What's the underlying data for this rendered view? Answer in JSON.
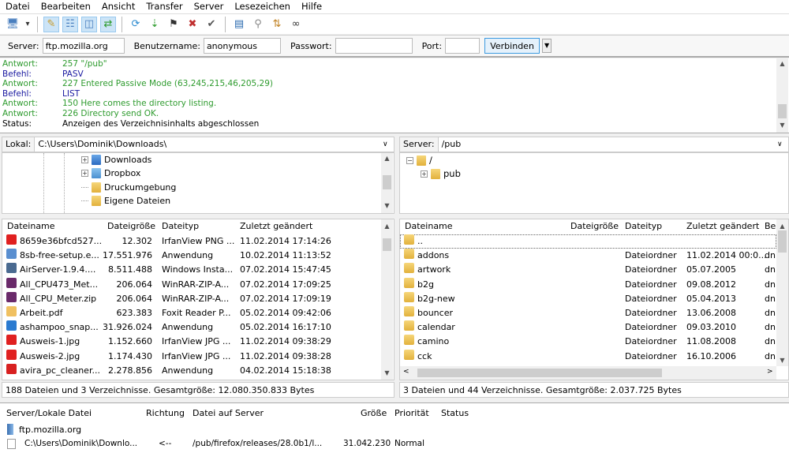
{
  "menu": [
    "Datei",
    "Bearbeiten",
    "Ansicht",
    "Transfer",
    "Server",
    "Lesezeichen",
    "Hilfe"
  ],
  "toolbar_icons": [
    "site-manager-icon",
    "dropdown-arrow-icon",
    "toggle-log-icon",
    "toggle-tree-icon",
    "toggle-remote-tree-icon",
    "toggle-queue-icon",
    "refresh-icon",
    "process-queue-icon",
    "cancel-icon",
    "disconnect-icon",
    "reconnect-icon",
    "directory-listing-filter-icon",
    "compare-directories-icon",
    "sync-browsing-icon",
    "search-icon"
  ],
  "quickconnect": {
    "server_label": "Server:",
    "server_value": "ftp.mozilla.org",
    "user_label": "Benutzername:",
    "user_value": "anonymous",
    "password_label": "Passwort:",
    "password_value": "",
    "port_label": "Port:",
    "port_value": "",
    "connect_label": "Verbinden"
  },
  "log": [
    {
      "type": "Antwort:",
      "text": "257 \"/pub\"",
      "color": "#2e9b2e"
    },
    {
      "type": "Befehl:",
      "text": "PASV",
      "color": "#1a1aa0"
    },
    {
      "type": "Antwort:",
      "text": "227 Entered Passive Mode (63,245,215,46,205,29)",
      "color": "#2e9b2e"
    },
    {
      "type": "Befehl:",
      "text": "LIST",
      "color": "#1a1aa0"
    },
    {
      "type": "Antwort:",
      "text": "150 Here comes the directory listing.",
      "color": "#2e9b2e"
    },
    {
      "type": "Antwort:",
      "text": "226 Directory send OK.",
      "color": "#2e9b2e"
    },
    {
      "type": "Status:",
      "text": "Anzeigen des Verzeichnisinhalts abgeschlossen",
      "color": "#000000"
    }
  ],
  "local": {
    "path_label": "Lokal:",
    "path": "C:\\Users\\Dominik\\Downloads\\",
    "tree": [
      "Downloads",
      "Dropbox",
      "Druckumgebung",
      "Eigene Dateien"
    ],
    "columns": [
      "Dateiname",
      "Dateigröße",
      "Dateityp",
      "Zuletzt geändert"
    ],
    "files": [
      {
        "name": "8659e36bfcd527...",
        "size": "12.302",
        "type": "IrfanView PNG ...",
        "modified": "11.02.2014 17:14:26",
        "icon": "irfanview-icon",
        "color": "#e02020"
      },
      {
        "name": "8sb-free-setup.e...",
        "size": "17.551.976",
        "type": "Anwendung",
        "modified": "10.02.2014 11:13:52",
        "icon": "setup-icon",
        "color": "#5a8fd0"
      },
      {
        "name": "AirServer-1.9.4....",
        "size": "8.511.488",
        "type": "Windows Insta...",
        "modified": "07.02.2014 15:47:45",
        "icon": "installer-icon",
        "color": "#4a6a90"
      },
      {
        "name": "All_CPU473_Met...",
        "size": "206.064",
        "type": "WinRAR-ZIP-A...",
        "modified": "07.02.2014 17:09:25",
        "icon": "winrar-icon",
        "color": "#6a2a6a"
      },
      {
        "name": "All_CPU_Meter.zip",
        "size": "206.064",
        "type": "WinRAR-ZIP-A...",
        "modified": "07.02.2014 17:09:19",
        "icon": "winrar-icon",
        "color": "#6a2a6a"
      },
      {
        "name": "Arbeit.pdf",
        "size": "623.383",
        "type": "Foxit Reader P...",
        "modified": "05.02.2014 09:42:06",
        "icon": "pdf-icon",
        "color": "#f0c060"
      },
      {
        "name": "ashampoo_snap...",
        "size": "31.926.024",
        "type": "Anwendung",
        "modified": "05.02.2014 16:17:10",
        "icon": "ashampoo-icon",
        "color": "#2a7ad0"
      },
      {
        "name": "Ausweis-1.jpg",
        "size": "1.152.660",
        "type": "IrfanView JPG ...",
        "modified": "11.02.2014 09:38:29",
        "icon": "irfanview-icon",
        "color": "#e02020"
      },
      {
        "name": "Ausweis-2.jpg",
        "size": "1.174.430",
        "type": "IrfanView JPG ...",
        "modified": "11.02.2014 09:38:28",
        "icon": "irfanview-icon",
        "color": "#e02020"
      },
      {
        "name": "avira_pc_cleaner...",
        "size": "2.278.856",
        "type": "Anwendung",
        "modified": "04.02.2014 15:18:38",
        "icon": "avira-icon",
        "color": "#d82020"
      }
    ],
    "status": "188 Dateien und 3 Verzeichnisse. Gesamtgröße: 12.080.350.833 Bytes"
  },
  "remote": {
    "path_label": "Server:",
    "path": "/pub",
    "tree": [
      "/",
      "pub"
    ],
    "columns": [
      "Dateiname",
      "Dateigröße",
      "Dateityp",
      "Zuletzt geändert",
      "Be"
    ],
    "files": [
      {
        "name": "..",
        "type": "",
        "modified": "",
        "perm": ""
      },
      {
        "name": "addons",
        "type": "Dateiordner",
        "modified": "11.02.2014 00:0...",
        "perm": "dn"
      },
      {
        "name": "artwork",
        "type": "Dateiordner",
        "modified": "05.07.2005",
        "perm": "dn"
      },
      {
        "name": "b2g",
        "type": "Dateiordner",
        "modified": "09.08.2012",
        "perm": "dn"
      },
      {
        "name": "b2g-new",
        "type": "Dateiordner",
        "modified": "05.04.2013",
        "perm": "dn"
      },
      {
        "name": "bouncer",
        "type": "Dateiordner",
        "modified": "13.06.2008",
        "perm": "dn"
      },
      {
        "name": "calendar",
        "type": "Dateiordner",
        "modified": "09.03.2010",
        "perm": "dn"
      },
      {
        "name": "camino",
        "type": "Dateiordner",
        "modified": "11.08.2008",
        "perm": "dn"
      },
      {
        "name": "cck",
        "type": "Dateiordner",
        "modified": "16.10.2006",
        "perm": "dn"
      }
    ],
    "status": "3 Dateien und 44 Verzeichnisse. Gesamtgröße: 2.037.725 Bytes"
  },
  "queue": {
    "columns": [
      "Server/Lokale Datei",
      "Richtung",
      "Datei auf Server",
      "Größe",
      "Priorität",
      "Status"
    ],
    "server": "ftp.mozilla.org",
    "items": [
      {
        "local": "C:\\Users\\Dominik\\Downlo...",
        "direction": "<--",
        "remote": "/pub/firefox/releases/28.0b1/l...",
        "size": "31.042.230",
        "priority": "Normal",
        "status": ""
      }
    ]
  }
}
